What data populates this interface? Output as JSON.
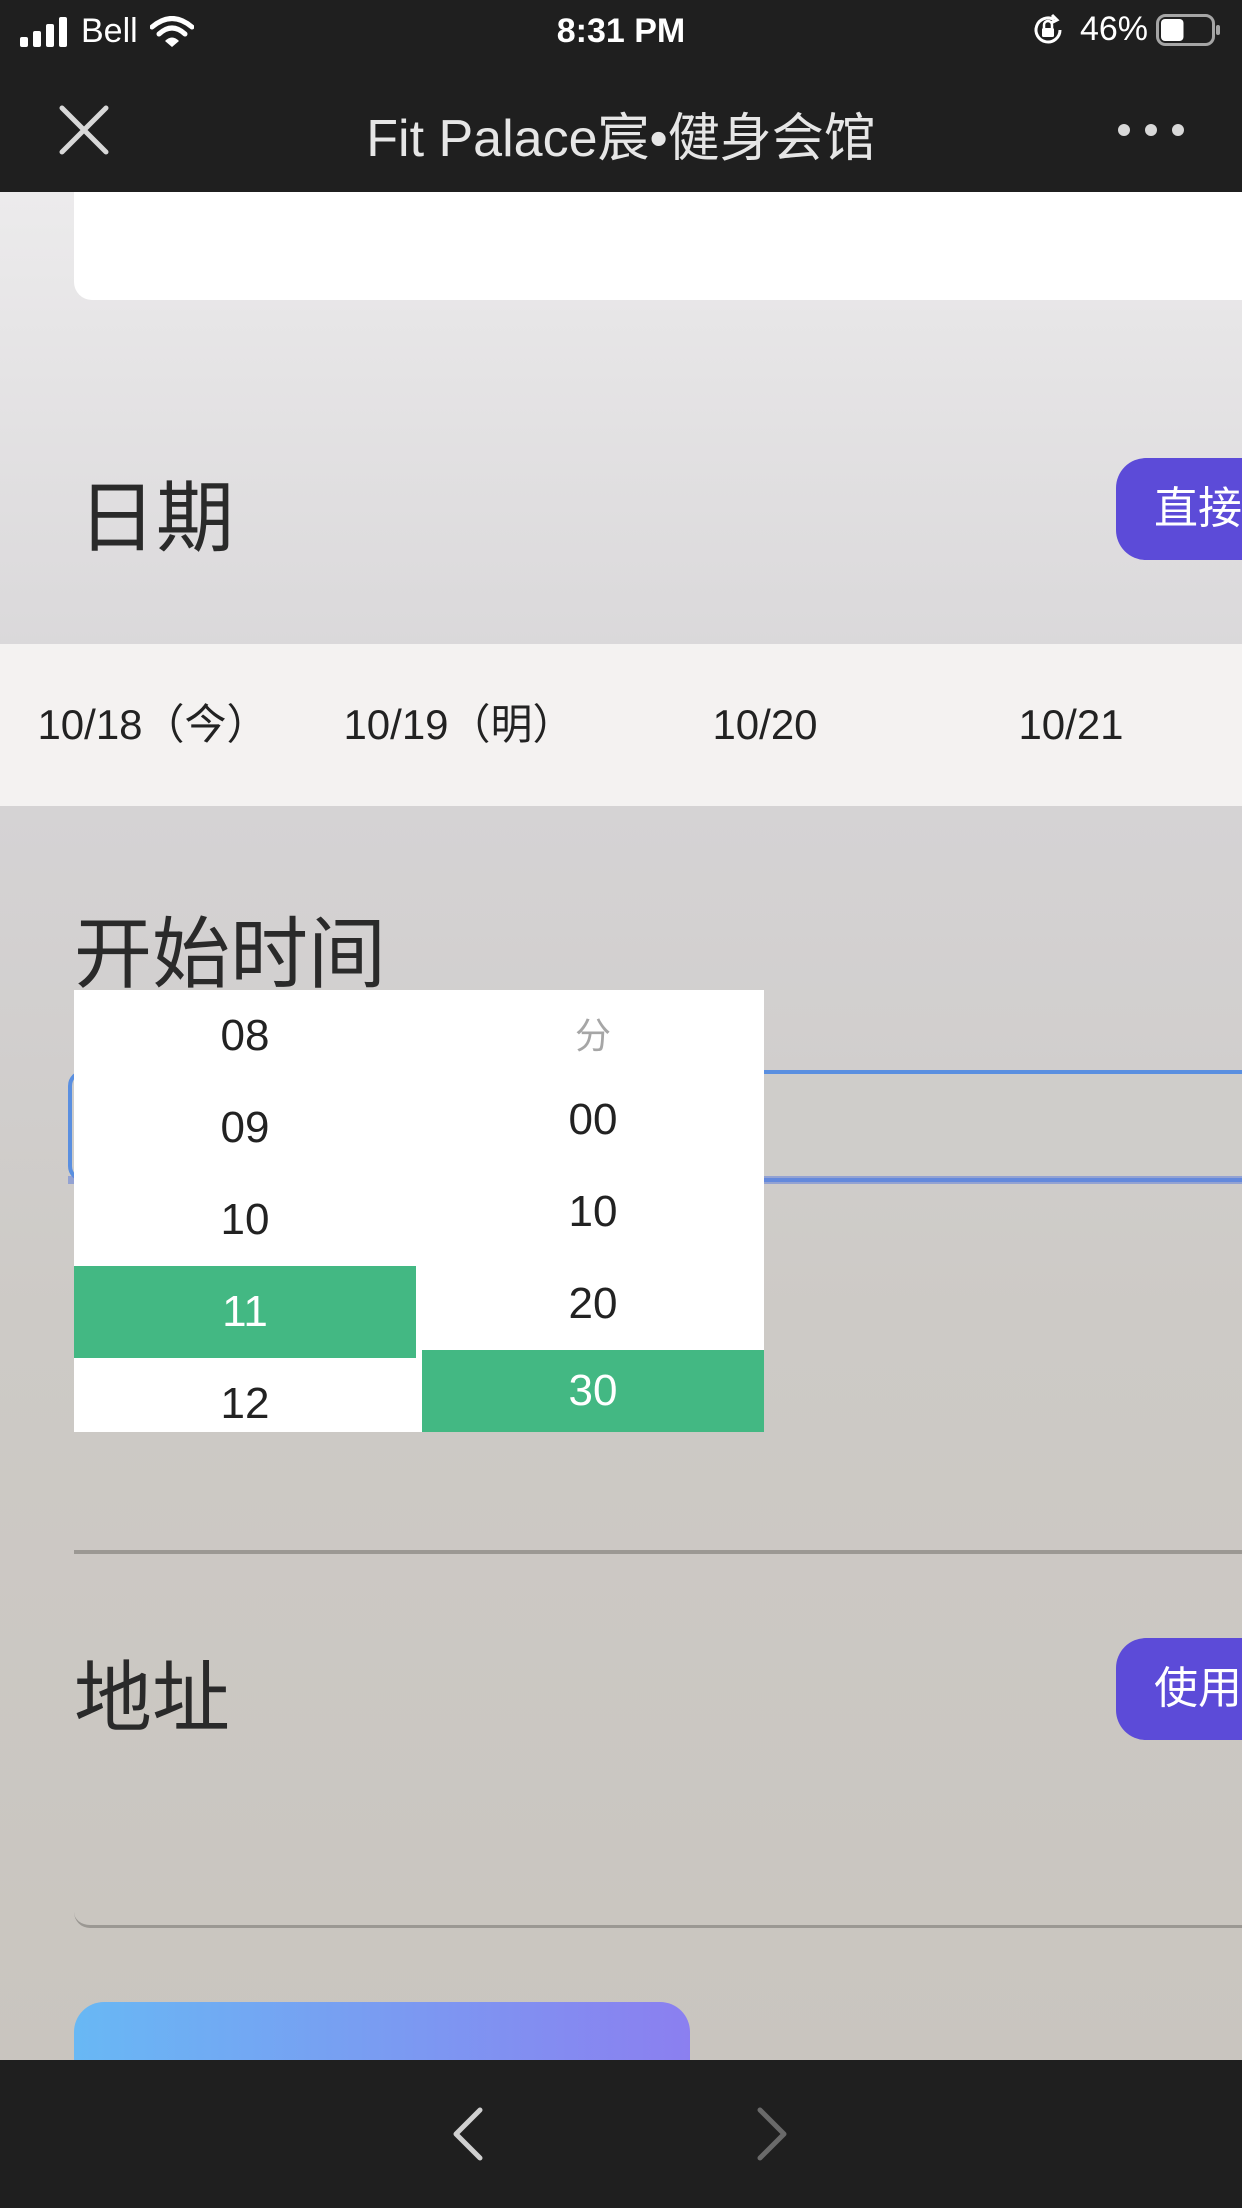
{
  "status_bar": {
    "carrier": "Bell",
    "time": "8:31 PM",
    "battery_percent": "46%",
    "battery_level": 0.46,
    "icons": [
      "signal-icon",
      "wifi-icon",
      "rotation-lock-icon",
      "battery-icon"
    ]
  },
  "nav": {
    "title": "Fit Palace宸•健身会馆",
    "close_icon": "close-icon",
    "more_icon": "more-icon"
  },
  "date_section": {
    "heading": "日期",
    "direct_button_label": "直接",
    "dates": [
      "10/18（今）",
      "10/19（明）",
      "10/20",
      "10/21"
    ]
  },
  "start_time_section": {
    "heading": "开始时间",
    "input_value": "11:30"
  },
  "time_picker": {
    "hours": [
      "08",
      "09",
      "10",
      "11",
      "12"
    ],
    "selected_hour": "11",
    "minutes_header": "分",
    "minutes": [
      "00",
      "10",
      "20",
      "30"
    ],
    "selected_minute": "30"
  },
  "address_section": {
    "heading": "地址",
    "use_button_label": "使用"
  },
  "toolbar": {
    "back_icon": "chevron-left-icon",
    "forward_icon": "chevron-right-icon"
  },
  "colors": {
    "bar_bg": "#1f1f1f",
    "accent_purple": "#5c4bd8",
    "picker_selected": "#43b883",
    "input_focus": "#5a8fe0"
  }
}
